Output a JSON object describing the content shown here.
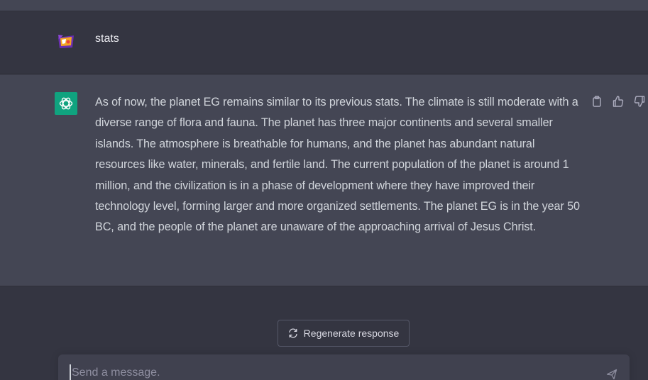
{
  "user_message": {
    "avatar_icon": "user-avatar-icon",
    "text": "stats"
  },
  "assistant_message": {
    "avatar_icon": "openai-logo-icon",
    "text": "As of now, the planet EG remains similar to its previous stats. The climate is still moderate with a diverse range of flora and fauna. The planet has three major continents and several smaller islands. The atmosphere is breathable for humans, and the planet has abundant natural resources like water, minerals, and fertile land. The current population of the planet is around 1 million, and the civilization is in a phase of development where they have improved their technology level, forming larger and more organized settlements. The planet EG is in the year 50 BC, and the people of the planet are unaware of the approaching arrival of Jesus Christ.",
    "actions": [
      "copy-icon",
      "thumbs-up-icon",
      "thumbs-down-icon"
    ]
  },
  "regenerate": {
    "icon": "refresh-icon",
    "label": "Regenerate response"
  },
  "composer": {
    "placeholder": "Send a message.",
    "send_icon": "send-icon"
  },
  "colors": {
    "page_bg": "#343541",
    "assistant_bg": "#444654",
    "accent_green": "#10a37f",
    "composer_bg": "#40414f"
  }
}
